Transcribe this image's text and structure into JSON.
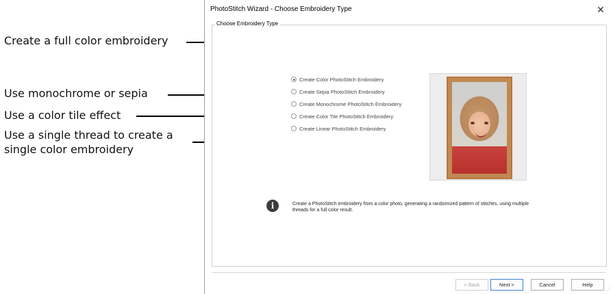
{
  "annotations": {
    "full_color": "Create a full color embroidery",
    "monochrome": "Use monochrome or sepia",
    "color_tile": "Use a color tile effect",
    "single_thread_line1": "Use a single thread to create a",
    "single_thread_line2": "single color embroidery"
  },
  "dialog": {
    "title": "PhotoStitch Wizard - Choose Embroidery Type",
    "close_glyph": "✕",
    "group_label": "Choose Embroidery Type",
    "options": [
      {
        "label": "Create Color PhotoStitch Embroidery",
        "selected": true
      },
      {
        "label": "Create Sepia PhotoStitch Embroidery",
        "selected": false
      },
      {
        "label": "Create Monochrome PhotoStitch Embroidery",
        "selected": false
      },
      {
        "label": "Create Color Tile PhotoStitch Embroidery",
        "selected": false
      },
      {
        "label": "Create Linear PhotoStitch Embroidery",
        "selected": false
      }
    ],
    "info_icon_glyph": "i",
    "info_text": "Create a PhotoStitch embroidery from a color photo, generating a randomized pattern of stitches, using multiple threads for a full color result.",
    "buttons": {
      "back": "< Back",
      "next": "Next >",
      "cancel": "Cancel",
      "help": "Help"
    },
    "grip_glyph": "⋰"
  },
  "colors": {
    "annotation_line": "#000000",
    "dialog_border": "#9a9a9a",
    "default_button_border": "#3c7fd4",
    "frame": "#c08a52"
  }
}
